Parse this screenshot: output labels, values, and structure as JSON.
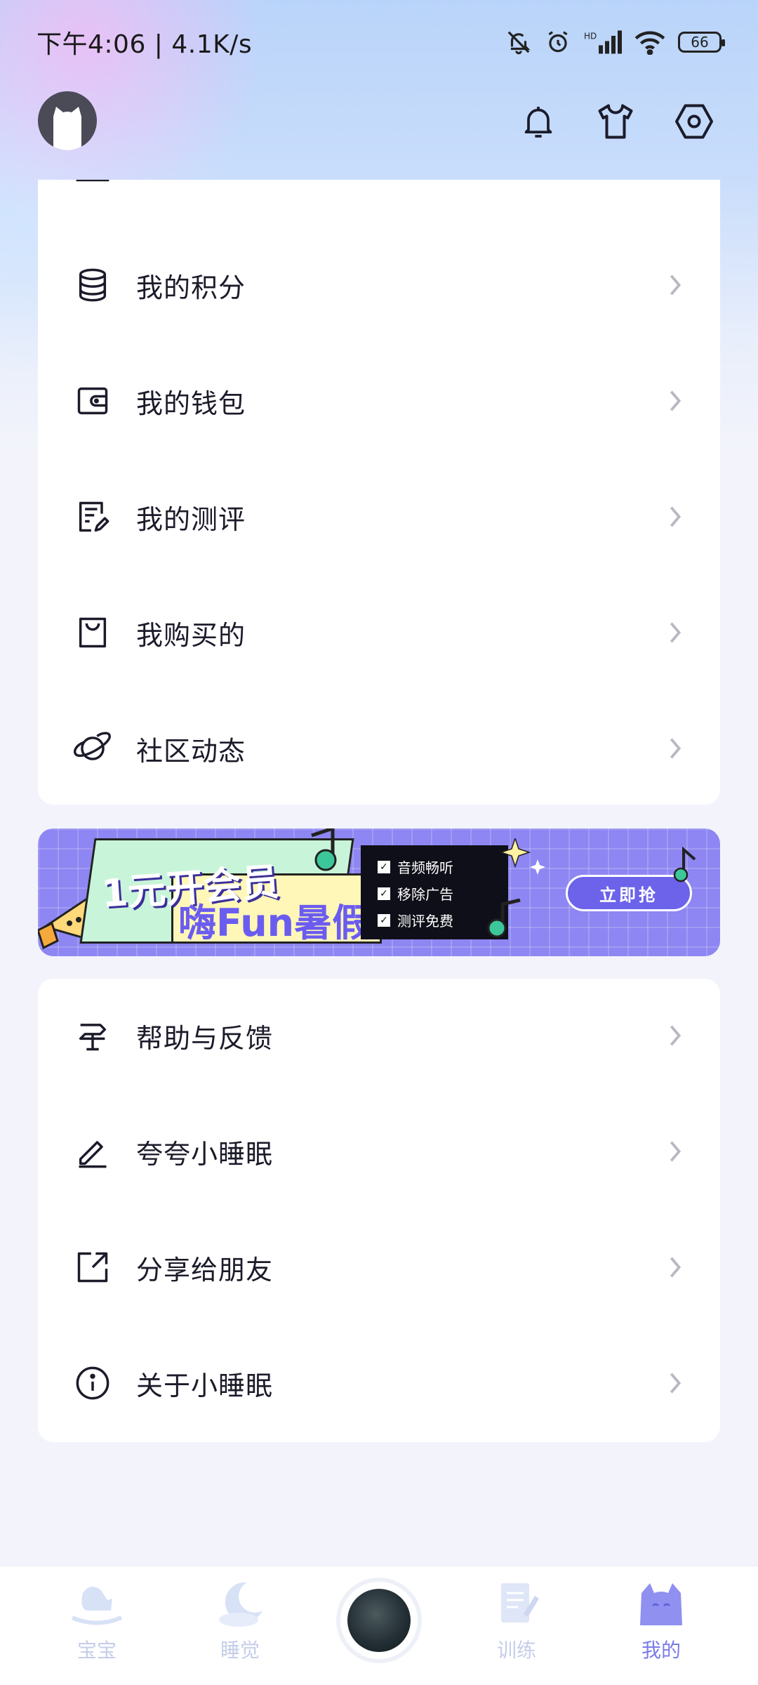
{
  "status_bar": {
    "time": "下午4:06 | 4.1K/s",
    "battery": "66"
  },
  "header": {
    "icons": [
      "bell-icon",
      "tshirt-icon",
      "settings-hexagon-icon"
    ]
  },
  "menu_group_1": {
    "items": [
      {
        "label": "我的积分",
        "icon": "coins-stack-icon"
      },
      {
        "label": "我的钱包",
        "icon": "wallet-icon"
      },
      {
        "label": "我的测评",
        "icon": "document-edit-icon"
      },
      {
        "label": "我购买的",
        "icon": "shopping-bag-icon"
      },
      {
        "label": "社区动态",
        "icon": "planet-icon"
      }
    ]
  },
  "banner": {
    "title_line1": "1元开会员",
    "title_line2": "嗨Fun暑假",
    "checks": [
      "音频畅听",
      "移除广告",
      "测评免费"
    ],
    "button": "立即抢"
  },
  "menu_group_2": {
    "items": [
      {
        "label": "帮助与反馈",
        "icon": "signpost-icon"
      },
      {
        "label": "夸夸小睡眠",
        "icon": "pen-icon"
      },
      {
        "label": "分享给朋友",
        "icon": "share-external-icon"
      },
      {
        "label": "关于小睡眠",
        "icon": "info-circle-icon"
      }
    ]
  },
  "bottom_nav": {
    "items": [
      {
        "label": "宝宝",
        "icon": "rocking-horse-icon",
        "active": false
      },
      {
        "label": "睡觉",
        "icon": "moon-cloud-icon",
        "active": false
      },
      {
        "label": "训练",
        "icon": "notebook-icon",
        "active": false
      },
      {
        "label": "我的",
        "icon": "cat-icon",
        "active": true
      }
    ],
    "accent_color": "#7b7cea",
    "inactive_color": "#c5cde8"
  }
}
